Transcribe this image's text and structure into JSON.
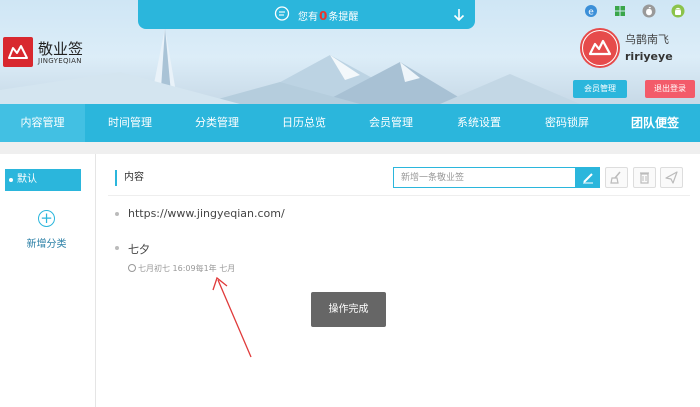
{
  "header": {
    "notice_prefix": "您有",
    "notice_count": "0",
    "notice_suffix": "条提醒",
    "logo_title": "敬业签",
    "logo_subtitle": "JINGYEQIAN",
    "user_name": "乌鹊南飞",
    "user_id": "ririyeye",
    "member_button": "会员管理",
    "logout_button": "退出登录",
    "platform_icons": [
      "ie-icon",
      "windows-icon",
      "apple-icon",
      "android-icon"
    ]
  },
  "nav": {
    "items": [
      "内容管理",
      "时间管理",
      "分类管理",
      "日历总览",
      "会员管理",
      "系统设置",
      "密码锁屏",
      "团队便签"
    ],
    "active_index": 0
  },
  "sidebar": {
    "default_label": "默认",
    "add_icon": "+",
    "add_label": "新增分类"
  },
  "main": {
    "section_title": "内容",
    "search_placeholder": "新增一条敬业签",
    "items": [
      {
        "text": "https://www.jingyeqian.com/"
      },
      {
        "text": "七夕",
        "meta": "七月初七 16:09每1年 七月"
      }
    ],
    "toast": "操作完成"
  },
  "colors": {
    "accent": "#2bb6dc",
    "logout": "#f35b6a",
    "logo": "#d8282f",
    "annotation": "#e03a3a"
  }
}
